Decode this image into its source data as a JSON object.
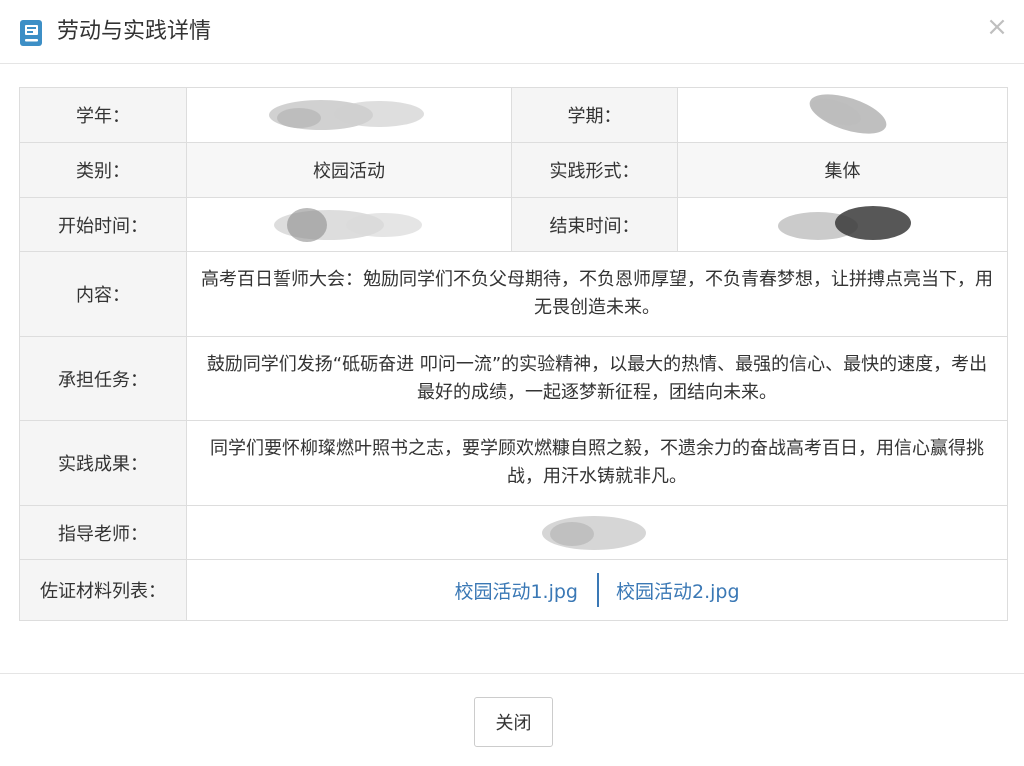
{
  "dialog": {
    "title": "劳动与实践详情",
    "icon": "book-icon",
    "close_glyph": "×",
    "close_button_label": "关闭"
  },
  "colors": {
    "icon_blue": "#3d8fc6",
    "link_blue": "#3a78b5",
    "label_bg": "#f5f5f5",
    "border": "#dddddd"
  },
  "details": {
    "school_year": {
      "label": "学年：",
      "value": ""
    },
    "semester": {
      "label": "学期：",
      "value": ""
    },
    "category": {
      "label": "类别：",
      "value": "校园活动"
    },
    "practice_form": {
      "label": "实践形式：",
      "value": "集体"
    },
    "start_time": {
      "label": "开始时间：",
      "value": ""
    },
    "end_time": {
      "label": "结束时间：",
      "value": ""
    },
    "content": {
      "label": "内容：",
      "value": "高考百日誓师大会：勉励同学们不负父母期待，不负恩师厚望，不负青春梦想，让拼搏点亮当下，用无畏创造未来。"
    },
    "tasks": {
      "label": "承担任务：",
      "value": "鼓励同学们发扬“砥砺奋进 叩问一流”的实验精神，以最大的热情、最强的信心、最快的速度，考出最好的成绩，一起逐梦新征程，团结向未来。"
    },
    "results": {
      "label": "实践成果：",
      "value": "同学们要怀柳璨燃叶照书之志，要学顾欢燃糠自照之毅，不遗余力的奋战高考百日，用信心赢得挑战，用汗水铸就非凡。"
    },
    "teacher": {
      "label": "指导老师：",
      "value": ""
    },
    "materials": {
      "label": "佐证材料列表：",
      "files": [
        "校园活动1.jpg",
        "校园活动2.jpg"
      ]
    }
  }
}
